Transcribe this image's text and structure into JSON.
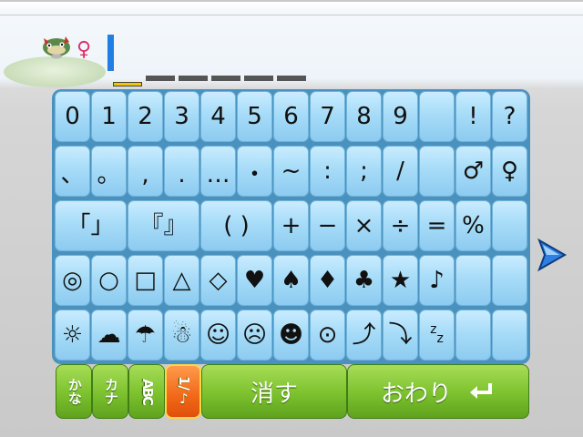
{
  "input": {
    "gender_symbol": "♀",
    "pokemon_icon": "pokemon-icon",
    "slot_count": 6,
    "active_slot_index": 0
  },
  "keyboard": {
    "rows": [
      [
        "0",
        "1",
        "2",
        "3",
        "4",
        "5",
        "6",
        "7",
        "8",
        "9",
        "",
        "!",
        "?"
      ],
      [
        "、",
        "。",
        ",",
        ".",
        "…",
        "・",
        "~",
        ":",
        ";",
        "/",
        "",
        "♂",
        "♀"
      ],
      [
        "「",
        "」",
        "",
        "『",
        "』",
        "",
        "(",
        ")",
        "+",
        "−",
        "×",
        "÷",
        "=",
        "%",
        ""
      ],
      [
        "◎",
        "○",
        "□",
        "△",
        "◇",
        "♥",
        "♠",
        "♦",
        "♣",
        "★",
        "♪",
        "",
        ""
      ],
      [
        "☼",
        "☁",
        "☂",
        "☃",
        "☺",
        "☹",
        "☻",
        "⊙",
        "⤴",
        "⤵",
        "zz",
        "",
        ""
      ]
    ]
  },
  "bottom_bar": {
    "modes": [
      {
        "id": "hiragana",
        "label": "かな"
      },
      {
        "id": "katakana",
        "label": "カナ"
      },
      {
        "id": "alphabet",
        "label": "ABC"
      },
      {
        "id": "symbols",
        "label": "1/♪"
      }
    ],
    "delete_label": "消す",
    "done_label": "おわり",
    "done_icon": "enter-icon"
  },
  "colors": {
    "key_blue": "#a7dcf8",
    "green": "#7cc12e",
    "active_orange": "#f06818",
    "caret_blue": "#1f7fe3"
  }
}
